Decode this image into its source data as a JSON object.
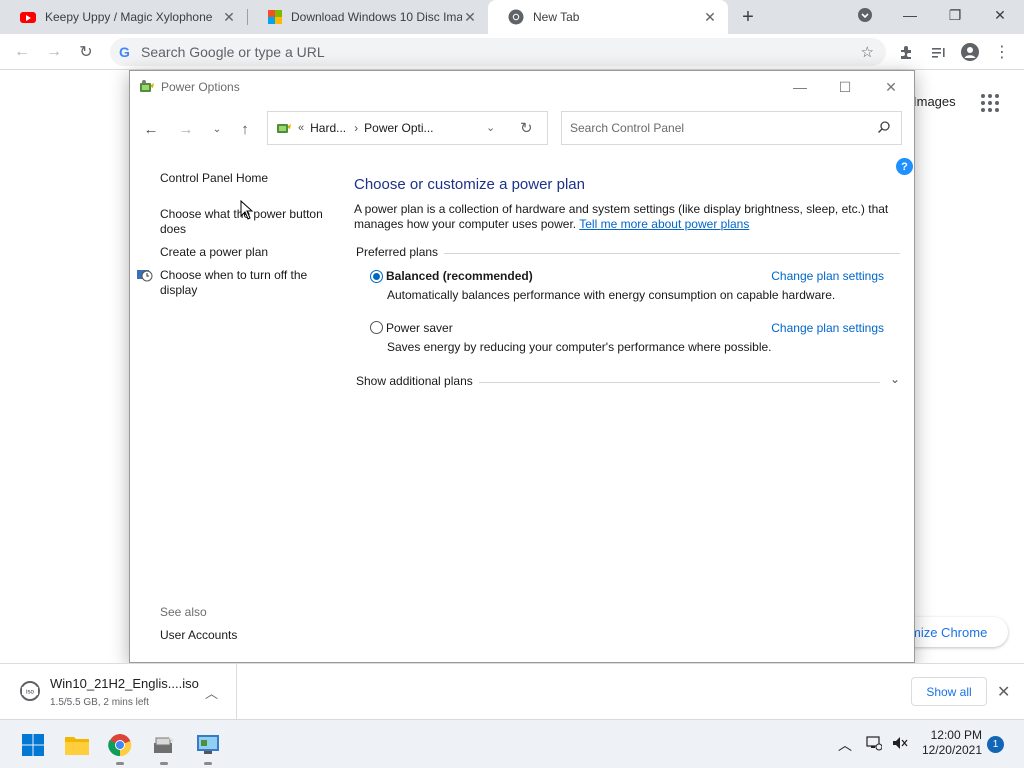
{
  "browser": {
    "tabs": [
      {
        "label": "Keepy Uppy / Magic Xylophone",
        "favicon": "youtube-icon"
      },
      {
        "label": "Download Windows 10 Disc Imag",
        "favicon": "microsoft-icon"
      },
      {
        "label": "New Tab",
        "favicon": "chrome-icon",
        "active": true
      }
    ],
    "omnibox_placeholder": "Search Google or type a URL",
    "ntp": {
      "images_link": "Images",
      "customize_label": "mize Chrome"
    }
  },
  "power_window": {
    "title": "Power Options",
    "breadcrumb": {
      "chevrons": "«",
      "parent": "Hard...",
      "current": "Power Opti..."
    },
    "search_placeholder": "Search Control Panel",
    "help_label": "?",
    "left_links": [
      {
        "label": "Control Panel Home"
      },
      {
        "label": "Choose what the power button does"
      },
      {
        "label": "Create a power plan"
      },
      {
        "label": "Choose when to turn off the display"
      }
    ],
    "see_also_label": "See also",
    "see_also_links": [
      "User Accounts"
    ],
    "heading": "Choose or customize a power plan",
    "description": "A power plan is a collection of hardware and system settings (like display brightness, sleep, etc.) that manages how your computer uses power.",
    "learn_more_link": "Tell me more about power plans",
    "preferred_label": "Preferred plans",
    "plans": [
      {
        "name": "Balanced (recommended)",
        "selected": true,
        "change_link": "Change plan settings",
        "description": "Automatically balances performance with energy consumption on capable hardware."
      },
      {
        "name": "Power saver",
        "selected": false,
        "change_link": "Change plan settings",
        "description": "Saves energy by reducing your computer's performance where possible."
      }
    ],
    "additional_label": "Show additional plans"
  },
  "downloads": {
    "file_name": "Win10_21H2_Englis....iso",
    "status": "1.5/5.5 GB, 2 mins left",
    "show_all_label": "Show all"
  },
  "taskbar": {
    "time": "12:00 PM",
    "date": "12/20/2021",
    "notification_count": "1"
  },
  "colors": {
    "accent_blue": "#1a73e8",
    "cp_heading": "#1e3287",
    "cp_link": "#0066cc",
    "radio_selected": "#0067c0"
  }
}
